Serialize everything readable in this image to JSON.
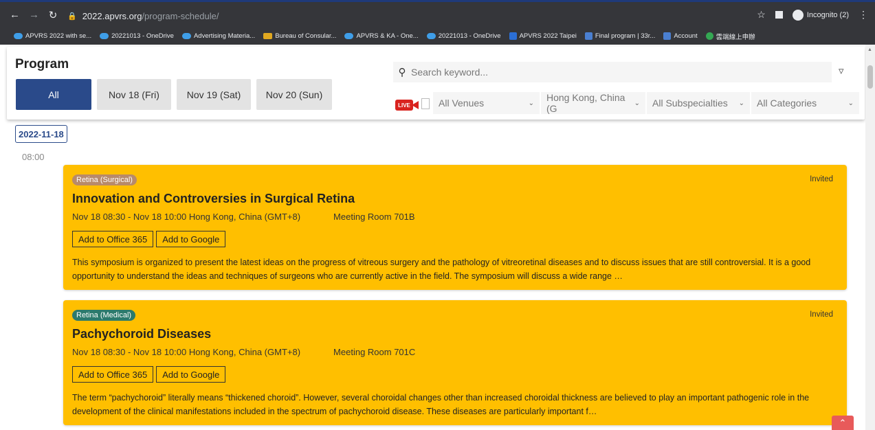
{
  "browser": {
    "url_host": "2022.apvrs.org",
    "url_path": "/program-schedule/",
    "incognito_label": "Incognito (2)",
    "bookmarks": [
      "APVRS 2022 with se...",
      "20221013 - OneDrive",
      "Advertising Materia...",
      "Bureau of Consular...",
      "APVRS & KA - One...",
      "20221013 - OneDrive",
      "APVRS 2022 Taipei",
      "Final program | 33r...",
      "Account",
      "雲端線上申辦"
    ]
  },
  "program": {
    "title": "Program",
    "tabs": [
      "All",
      "Nov 18 (Fri)",
      "Nov 19 (Sat)",
      "Nov 20 (Sun)"
    ],
    "active_tab": "All",
    "search_placeholder": "Search keyword...",
    "live_label": "LIVE",
    "filters": {
      "venues": "All Venues",
      "timezone": "Hong Kong, China (G",
      "subspecialties": "All Subspecialties",
      "categories": "All Categories"
    }
  },
  "schedule": {
    "date": "2022-11-18",
    "time": "08:00",
    "sessions": [
      {
        "tag": "Retina (Surgical)",
        "type": "Invited",
        "title": "Innovation and Controversies in Surgical Retina",
        "time": "Nov 18 08:30 - Nov 18 10:00 Hong Kong, China (GMT+8)",
        "room": "Meeting Room 701B",
        "office_btn": "Add to Office 365",
        "google_btn": "Add to Google",
        "description": "This symposium is organized to present the latest ideas on the progress of vitreous surgery and the pathology of vitreoretinal diseases and to discuss issues that are still controversial. It is a good opportunity to understand the ideas and techniques of surgeons who are currently active in the field. The symposium will discuss a wide range …"
      },
      {
        "tag": "Retina (Medical)",
        "type": "Invited",
        "title": "Pachychoroid Diseases",
        "time": "Nov 18 08:30 - Nov 18 10:00 Hong Kong, China (GMT+8)",
        "room": "Meeting Room 701C",
        "office_btn": "Add to Office 365",
        "google_btn": "Add to Google",
        "description": "The term “pachychoroid” literally means “thickened choroid”. However, several choroidal changes other than increased choroidal thickness are believed to play an important pathogenic role in the development of the clinical manifestations included in the spectrum of pachychoroid disease. These diseases are particularly important f…"
      }
    ]
  },
  "colors": {
    "accent": "#2a4a8a",
    "card_bg": "#ffbf00",
    "live_red": "#d9231f",
    "surgical_tag": "#b88a6a",
    "medical_tag": "#2c7a6c"
  }
}
